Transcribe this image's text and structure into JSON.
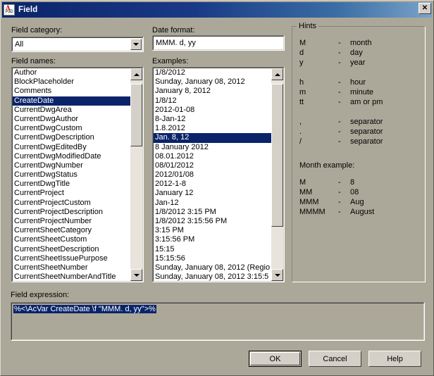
{
  "window": {
    "title": "Field",
    "icon": "autocad-field-icon",
    "close_label": "✕",
    "icon_letter": "A",
    "icon_sub": "P3D"
  },
  "labels": {
    "field_category": "Field category:",
    "field_names": "Field names:",
    "date_format": "Date format:",
    "examples": "Examples:",
    "field_expression": "Field expression:"
  },
  "field_category": {
    "selected": "All",
    "options": [
      "All"
    ]
  },
  "date_format": {
    "value": "MMM. d, yy",
    "placeholder": ""
  },
  "field_names": {
    "selected": "CreateDate",
    "items": [
      "Author",
      "BlockPlaceholder",
      "Comments",
      "CreateDate",
      "CurrentDwgArea",
      "CurrentDwgAuthor",
      "CurrentDwgCustom",
      "CurrentDwgDescription",
      "CurrentDwgEditedBy",
      "CurrentDwgModifiedDate",
      "CurrentDwgNumber",
      "CurrentDwgStatus",
      "CurrentDwgTitle",
      "CurrentProject",
      "CurrentProjectCustom",
      "CurrentProjectDescription",
      "CurrentProjectNumber",
      "CurrentSheetCategory",
      "CurrentSheetCustom",
      "CurrentSheetDescription",
      "CurrentSheetIssuePurpose",
      "CurrentSheetNumber",
      "CurrentSheetNumberAndTitle"
    ],
    "scroll_thumb_top_pct": 2,
    "scroll_thumb_height_pct": 33
  },
  "examples": {
    "selected": "Jan. 8, 12",
    "items": [
      "1/8/2012",
      "Sunday, January 08, 2012",
      "January 8, 2012",
      "1/8/12",
      "2012-01-08",
      "8-Jan-12",
      "1.8.2012",
      "Jan. 8, 12",
      "8 January 2012",
      "08.01.2012",
      "08/01/2012",
      "2012/01/08",
      "2012-1-8",
      "January 12",
      "Jan-12",
      "1/8/2012 3:15 PM",
      "1/8/2012 3:15:56 PM",
      "3:15 PM",
      "3:15:56 PM",
      "15:15",
      "15:15:56",
      "Sunday, January 08, 2012 (Regio",
      "Sunday, January 08, 2012 3:15:5"
    ],
    "scroll_thumb_top_pct": 2,
    "scroll_thumb_height_pct": 75
  },
  "hints": {
    "legend": "Hints",
    "rows": [
      {
        "key": "M",
        "dash": "-",
        "value": "month"
      },
      {
        "key": "d",
        "dash": "-",
        "value": "day"
      },
      {
        "key": "y",
        "dash": "-",
        "value": "year"
      },
      {
        "key": "h",
        "dash": "-",
        "value": "hour"
      },
      {
        "key": "m",
        "dash": "-",
        "value": "minute"
      },
      {
        "key": "tt",
        "dash": "-",
        "value": "am or pm"
      },
      {
        "key": ",",
        "dash": "-",
        "value": "separator"
      },
      {
        "key": ".",
        "dash": "-",
        "value": "separator"
      },
      {
        "key": "/",
        "dash": "-",
        "value": "separator"
      }
    ],
    "month_example_title": "Month example:",
    "month_rows": [
      {
        "key": "M",
        "dash": "-",
        "value": "8"
      },
      {
        "key": "MM",
        "dash": "-",
        "value": "08"
      },
      {
        "key": "MMM",
        "dash": "-",
        "value": "Aug"
      },
      {
        "key": "MMMM",
        "dash": "-",
        "value": "August"
      }
    ]
  },
  "field_expression": {
    "value": "%<\\AcVar CreateDate \\f \"MMM. d, yy\">%",
    "selected": true
  },
  "buttons": {
    "ok": "OK",
    "cancel": "Cancel",
    "help": "Help"
  },
  "colors": {
    "dialog_face": "#aca899",
    "titlebar_start": "#0a246a",
    "titlebar_end": "#7ba3c9",
    "selection": "#0a246a",
    "selection_text": "#ffffff",
    "control_face": "#d4d0c8",
    "field_bg": "#ffffff"
  }
}
